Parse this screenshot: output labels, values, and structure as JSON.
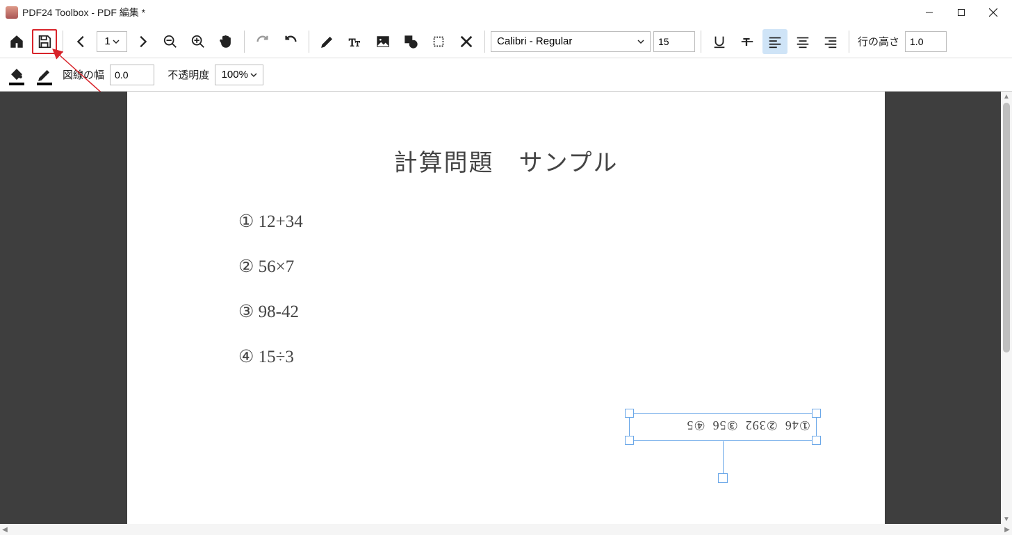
{
  "titlebar": {
    "title": "PDF24 Toolbox - PDF 編集 *"
  },
  "toolbar": {
    "page_number": "1",
    "font_name": "Calibri - Regular",
    "font_size": "15",
    "line_height_label": "行の高さ",
    "line_height_value": "1.0"
  },
  "toolbar2": {
    "line_width_label": "図線の幅",
    "line_width_value": "0.0",
    "opacity_label": "不透明度",
    "opacity_value": "100%"
  },
  "document": {
    "title": "計算問題　サンプル",
    "problems": [
      "① 12+34",
      "② 56×7",
      "③ 98-42",
      "④ 15÷3"
    ],
    "rotated_answers": [
      "①46",
      "②392",
      "③56",
      "④5"
    ]
  }
}
